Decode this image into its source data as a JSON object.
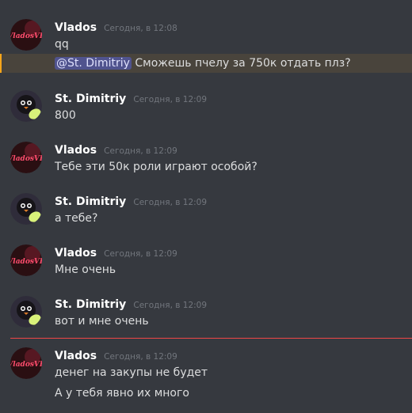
{
  "users": {
    "vlados": {
      "name": "Vlados",
      "avatar_text": "VladosVP",
      "avatar_bg": "#2a0f12",
      "avatar_text_color": "#ff4d6d"
    },
    "dimitriy": {
      "name": "St. Dimitriy",
      "avatar_bg": "#2f2c3a",
      "avatar_accent": "#d9f27a"
    }
  },
  "messages": [
    {
      "user": "Vlados",
      "time": "Сегодня, в 12:08",
      "lines": [
        "qq"
      ],
      "mention_line": {
        "mention": "@St. Dimitriy",
        "text": " Сможешь пчелу за 750к отдать плз?"
      }
    },
    {
      "user": "St. Dimitriy",
      "time": "Сегодня, в 12:09",
      "lines": [
        "800"
      ]
    },
    {
      "user": "Vlados",
      "time": "Сегодня, в 12:09",
      "lines": [
        "Тебе эти 50к роли играют особой?"
      ]
    },
    {
      "user": "St. Dimitriy",
      "time": "Сегодня, в 12:09",
      "lines": [
        "а тебе?"
      ]
    },
    {
      "user": "Vlados",
      "time": "Сегодня, в 12:09",
      "lines": [
        "Мне очень"
      ]
    },
    {
      "user": "St. Dimitriy",
      "time": "Сегодня, в 12:09",
      "lines": [
        "вот и мне очень"
      ]
    },
    {
      "user": "Vlados",
      "time": "Сегодня, в 12:09",
      "lines": [
        "денег на закупы не будет",
        "А у тебя явно их много"
      ]
    }
  ],
  "colors": {
    "background": "#36393f",
    "mention_highlight": "#49443c",
    "new_messages_line": "#f04747"
  }
}
